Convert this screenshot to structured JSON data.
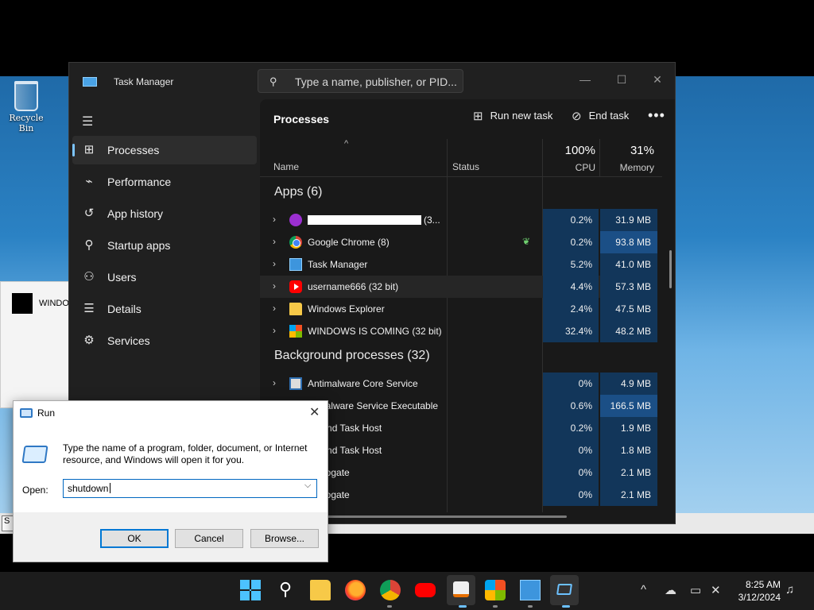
{
  "desktop": {
    "recycle_bin_label": "Recycle Bin",
    "bg_window_label": "WINDOW",
    "bg_strip_button": "S"
  },
  "task_manager": {
    "title": "Task Manager",
    "search_placeholder": "Type a name, publisher, or PID...",
    "window_controls": {
      "minimize": "—",
      "maximize": "☐",
      "close": "✕"
    },
    "nav": [
      {
        "label": "Processes",
        "icon": "processes-icon",
        "glyph": "⊞",
        "active": true
      },
      {
        "label": "Performance",
        "icon": "performance-icon",
        "glyph": "⌁"
      },
      {
        "label": "App history",
        "icon": "history-icon",
        "glyph": "↺"
      },
      {
        "label": "Startup apps",
        "icon": "startup-icon",
        "glyph": "⚲"
      },
      {
        "label": "Users",
        "icon": "users-icon",
        "glyph": "⚇"
      },
      {
        "label": "Details",
        "icon": "details-icon",
        "glyph": "☰"
      },
      {
        "label": "Services",
        "icon": "services-icon",
        "glyph": "⚙"
      }
    ],
    "pane_title": "Processes",
    "toolbar": {
      "run_new_task": "Run new task",
      "end_task": "End task",
      "more": "•••"
    },
    "columns": {
      "name": "Name",
      "status": "Status",
      "cpu_pct": "100%",
      "cpu": "CPU",
      "memory_pct": "31%",
      "memory": "Memory"
    },
    "apps_group": "Apps (6)",
    "apps": [
      {
        "name": "(3...",
        "redacted": true,
        "cpu": "0.2%",
        "memory": "31.9 MB",
        "icon": "puzzle-icon"
      },
      {
        "name": "Google Chrome (8)",
        "cpu": "0.2%",
        "memory": "93.8 MB",
        "icon": "chrome-icon",
        "status_icon": "eco-leaf-icon",
        "memory_hot": true
      },
      {
        "name": "Task Manager",
        "cpu": "5.2%",
        "memory": "41.0 MB",
        "icon": "task-manager-icon"
      },
      {
        "name": "username666 (32 bit)",
        "cpu": "4.4%",
        "memory": "57.3 MB",
        "icon": "youtube-icon",
        "selected": true
      },
      {
        "name": "Windows Explorer",
        "cpu": "2.4%",
        "memory": "47.5 MB",
        "icon": "folder-icon"
      },
      {
        "name": "WINDOWS IS COMING (32 bit)",
        "cpu": "32.4%",
        "memory": "48.2 MB",
        "icon": "windows-logo-icon"
      }
    ],
    "bg_group": "Background processes (32)",
    "background": [
      {
        "name": "Antimalware Core Service",
        "cpu": "0%",
        "memory": "4.9 MB",
        "expandable": true
      },
      {
        "name": "ntimalware Service Executable",
        "cpu": "0.6%",
        "memory": "166.5 MB",
        "memory_hot": true
      },
      {
        "name": "ground Task Host",
        "cpu": "0.2%",
        "memory": "1.9 MB"
      },
      {
        "name": "ground Task Host",
        "cpu": "0%",
        "memory": "1.8 MB"
      },
      {
        "name": "Surrogate",
        "cpu": "0%",
        "memory": "2.1 MB"
      },
      {
        "name": "Surrogate",
        "cpu": "0%",
        "memory": "2.1 MB"
      }
    ]
  },
  "run_dialog": {
    "title": "Run",
    "close": "✕",
    "description": "Type the name of a program, folder, document, or Internet resource, and Windows will open it for you.",
    "open_label": "Open:",
    "open_value": "shutdown",
    "ok": "OK",
    "cancel": "Cancel",
    "browse": "Browse..."
  },
  "taskbar": {
    "time": "8:25 AM",
    "date": "3/12/2024"
  },
  "colors": {
    "tm_bg": "#202020",
    "cpu_fill": "#12365a",
    "memory_hot_fill": "#1b4f86",
    "accent": "#0078d4"
  }
}
